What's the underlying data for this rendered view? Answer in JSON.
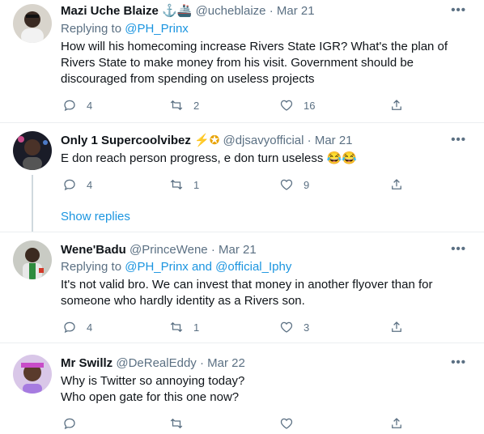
{
  "tweets": [
    {
      "name": "Mazi Uche Blaize",
      "emoji": "⚓🚢",
      "handle": "@ucheblaize",
      "date": "Mar 21",
      "replying_label": "Replying to",
      "replying_to": "@PH_Prinx",
      "replying_extra": "",
      "text": "How will his homecoming increase Rivers State IGR? What's the plan of Rivers State to make money from his visit. Government should be discouraged from spending on useless projects",
      "replies": "4",
      "retweets": "2",
      "likes": "16"
    },
    {
      "name": "Only 1 Supercoolvibez",
      "emoji": "⚡✪",
      "handle": "@djsavyofficial",
      "date": "Mar 21",
      "text": "E don reach person progress, e don turn useless 😂😂",
      "replies": "4",
      "retweets": "1",
      "likes": "9"
    },
    {
      "name": "Wene'Badu",
      "handle": "@PrinceWene",
      "date": "Mar 21",
      "replying_label": "Replying to",
      "replying_to": "@PH_Prinx and @official_Iphy",
      "text": "It's not valid bro. We can invest that money in another flyover than for someone who hardly identity as a Rivers son.",
      "replies": "4",
      "retweets": "1",
      "likes": "3"
    },
    {
      "name": "Mr Swillz",
      "handle": "@DeRealEddy",
      "date": "Mar 22",
      "text_line1": "Why is Twitter so annoying today?",
      "text_line2": "Who open gate for this one now?",
      "replies": "",
      "retweets": "",
      "likes": ""
    }
  ],
  "show_replies": "Show replies",
  "separator": "·",
  "more_icon": "•••",
  "colors": {
    "accent": "#1b95e0",
    "muted": "#5b7083",
    "border": "#ebeef0"
  }
}
